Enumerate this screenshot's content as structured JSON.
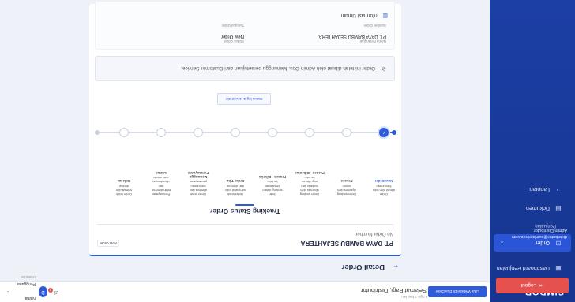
{
  "app": {
    "brand": "SIMDOR"
  },
  "sidebar": {
    "items": [
      {
        "label": "Dashboard Penjualan",
        "icon": "dashboard-icon"
      },
      {
        "label": "Order",
        "icon": "cart-icon",
        "active": true
      },
      {
        "label": "Penjualan",
        "sub": true
      },
      {
        "label": "Dokumen",
        "icon": "document-icon"
      },
      {
        "label": "Laporan",
        "icon": "report-icon"
      }
    ],
    "user_email": "distributor@sumberindo.com",
    "user_role": "Admin Distributor",
    "logout_label": "Logout"
  },
  "topbar": {
    "greeting": "Selamat Pagi, Distributor",
    "greeting_sub": "Login 3 hari lalu",
    "action_label": "Lihat Website DI Dua Order",
    "notif_count": "0",
    "profile_name": "Nama Pengguna",
    "profile_role": "Distributor",
    "avatar_initial": "D"
  },
  "page": {
    "title": "Detail Order",
    "shop_name": "PT. DAYA BAMBU SEJAHTERA",
    "order_number": "No Order Number",
    "status": "New Order",
    "tracking_title": "Tracking Status Order",
    "steps": [
      {
        "name": "New Order",
        "lines": [
          "Order",
          "dibuat oleh toko",
          "Menunggu"
        ],
        "state": "done",
        "highlight": true
      },
      {
        "name": "Proses",
        "lines": [
          "Order sedang",
          "diproses oleh",
          "admin"
        ],
        "state": "pending"
      },
      {
        "name": "Proses - Dikemas",
        "lines": [
          "Order sedang",
          "dikemas oleh",
          "gudang dan",
          "siap dikirim",
          "ke toko"
        ],
        "state": "pending"
      },
      {
        "name": "Proses - Dikirim",
        "lines": [
          "Order",
          "sedang dalam",
          "perjalanan",
          "ke toko"
        ],
        "state": "pending"
      },
      {
        "name": "Order Tiba",
        "lines": [
          "Order telah",
          "sampai di toko",
          "dan diterima"
        ],
        "state": "pending"
      },
      {
        "name": "Menunggu Pembayaran",
        "lines": [
          "Order telah",
          "diterima dan",
          "menunggu",
          "pembayaran"
        ],
        "state": "pending"
      },
      {
        "name": "Lunas",
        "lines": [
          "Pembayaran",
          "telah diterima",
          "dan",
          "dikonfirmasi",
          "oleh admin"
        ],
        "state": "pending"
      },
      {
        "name": "Selesai",
        "lines": [
          "Order telah",
          "selesai dan",
          "ditutup"
        ],
        "state": "pending"
      }
    ],
    "link_label": "Status log & New Order",
    "notice": "Order ini telah dibuat oleh Admin Ops. Menunggu persetujuan dari Customer Service.",
    "invoice_title": "Informasi Umum",
    "invoice_fields": [
      {
        "key": "Nama Pelanggan",
        "value": "PT. DAYA BAMBU SEJAHTERA"
      },
      {
        "key": "Status Order",
        "value": "New Order"
      },
      {
        "key": "Sumber Order",
        "value": ""
      },
      {
        "key": "Tanggal Order",
        "value": ""
      }
    ]
  },
  "colors": {
    "primary": "#2f5bd8",
    "sidebar": "#16358f",
    "danger": "#e4514e"
  }
}
